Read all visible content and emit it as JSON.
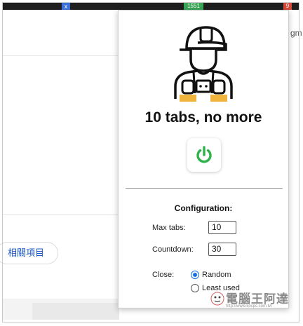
{
  "browser": {
    "ext_badge_x": "x",
    "ext_badge_count": "1551",
    "ext_badge_red": "9"
  },
  "background_page": {
    "related_button": "相關項目",
    "partial_text": "gm"
  },
  "popup": {
    "mascot_icon": "worker-mascot-icon",
    "title": "10 tabs, no more",
    "power_icon": "power-icon",
    "power_color": "#2eb34a",
    "config": {
      "heading": "Configuration:",
      "max_tabs_label": "Max tabs:",
      "max_tabs_value": "10",
      "countdown_label": "Countdown:",
      "countdown_value": "30",
      "close_label": "Close:",
      "close_options": [
        {
          "label": "Random",
          "selected": true
        },
        {
          "label": "Least used",
          "selected": false
        }
      ]
    }
  },
  "watermark": {
    "text": "電腦王阿達",
    "url": "http://www.kocpc.com.tw"
  },
  "colors": {
    "accent": "#1a6fe0",
    "mascot_orange": "#f0b43c"
  }
}
